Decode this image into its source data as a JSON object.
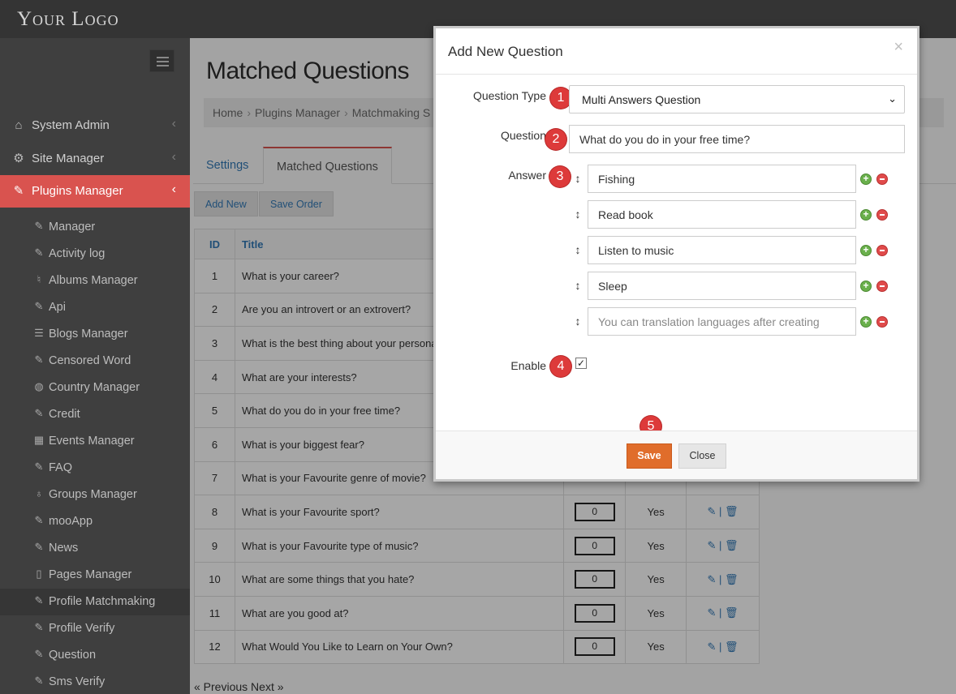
{
  "header": {
    "logo": "Your Logo"
  },
  "sidebar": {
    "main_items": [
      {
        "label": "System Admin",
        "icon": "home-icon"
      },
      {
        "label": "Site Manager",
        "icon": "gears-icon"
      },
      {
        "label": "Plugins Manager",
        "icon": "plug-icon",
        "active": true
      }
    ],
    "sub_items": [
      {
        "label": "Manager",
        "icon": "plug-icon"
      },
      {
        "label": "Activity log",
        "icon": "plug-icon"
      },
      {
        "label": "Albums Manager",
        "icon": "albums-icon"
      },
      {
        "label": "Api",
        "icon": "plug-icon"
      },
      {
        "label": "Blogs Manager",
        "icon": "blog-icon"
      },
      {
        "label": "Censored Word",
        "icon": "plug-icon"
      },
      {
        "label": "Country Manager",
        "icon": "globe-icon"
      },
      {
        "label": "Credit",
        "icon": "plug-icon"
      },
      {
        "label": "Events Manager",
        "icon": "calendar-icon"
      },
      {
        "label": "FAQ",
        "icon": "plug-icon"
      },
      {
        "label": "Groups Manager",
        "icon": "groups-icon"
      },
      {
        "label": "mooApp",
        "icon": "plug-icon"
      },
      {
        "label": "News",
        "icon": "plug-icon"
      },
      {
        "label": "Pages Manager",
        "icon": "page-icon"
      },
      {
        "label": "Profile Matchmaking",
        "icon": "plug-icon",
        "highlight": true
      },
      {
        "label": "Profile Verify",
        "icon": "plug-icon"
      },
      {
        "label": "Question",
        "icon": "plug-icon"
      },
      {
        "label": "Sms Verify",
        "icon": "plug-icon"
      }
    ]
  },
  "main": {
    "title": "Matched Questions",
    "breadcrumb": [
      "Home",
      "Plugins Manager",
      "Matchmaking S"
    ],
    "tabs": [
      "Settings",
      "Matched Questions"
    ],
    "buttons": {
      "add_new": "Add New",
      "save_order": "Save Order"
    },
    "table": {
      "headers": [
        "ID",
        "Title"
      ],
      "rows": [
        {
          "id": "1",
          "title": "What is your career?"
        },
        {
          "id": "2",
          "title": "Are you an introvert or an extrovert?"
        },
        {
          "id": "3",
          "title": "What is the best thing about your persona"
        },
        {
          "id": "4",
          "title": "What are your interests?"
        },
        {
          "id": "5",
          "title": "What do you do in your free time?"
        },
        {
          "id": "6",
          "title": "What is your biggest fear?"
        },
        {
          "id": "7",
          "title": "What is your Favourite genre of movie?"
        },
        {
          "id": "8",
          "title": "What is your Favourite sport?",
          "order": "0",
          "active": "Yes"
        },
        {
          "id": "9",
          "title": "What is your Favourite type of music?",
          "order": "0",
          "active": "Yes"
        },
        {
          "id": "10",
          "title": "What are some things that you hate?",
          "order": "0",
          "active": "Yes"
        },
        {
          "id": "11",
          "title": "What are you good at?",
          "order": "0",
          "active": "Yes"
        },
        {
          "id": "12",
          "title": "What Would You Like to Learn on Your Own?",
          "order": "0",
          "active": "Yes"
        }
      ]
    },
    "pager": {
      "previous": "« Previous",
      "next": "Next »"
    }
  },
  "modal": {
    "title": "Add New Question",
    "close_glyph": "×",
    "question_type_label": "Question Type",
    "question_type_value": "Multi Answers Question",
    "question_label": "Question",
    "question_value": "What do you do in your free time?",
    "answer_label": "Answer",
    "answers": [
      "Fishing",
      "Read book",
      "Listen to music",
      "Sleep"
    ],
    "answer_placeholder": "You can translation languages after creating",
    "enable_label": "Enable",
    "enable_checked": true,
    "steps": [
      "1",
      "2",
      "3",
      "4",
      "5"
    ],
    "save_label": "Save",
    "close_label": "Close"
  },
  "colors": {
    "accent": "#d9534f",
    "save": "#e06d2b",
    "badge": "#dd3a3a",
    "link": "#337ab7"
  }
}
